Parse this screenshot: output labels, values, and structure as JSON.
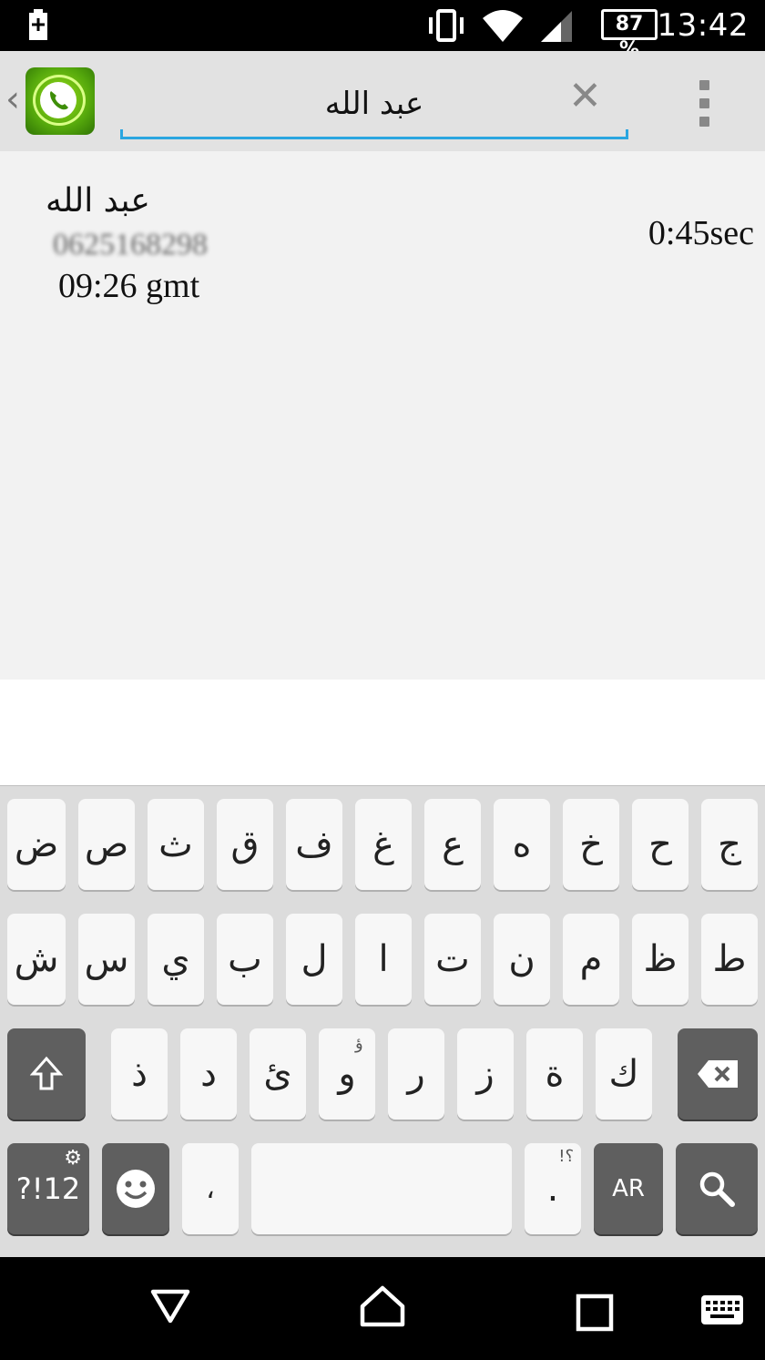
{
  "status_bar": {
    "time": "13:42",
    "battery_percent": "87 %",
    "icons": [
      "battery-charging-icon",
      "vibrate-icon",
      "wifi-icon",
      "signal-icon"
    ]
  },
  "action_bar": {
    "search_value": "عبد الله",
    "search_placeholder": "",
    "icons": [
      "back-chevron-icon",
      "app-phone-icon",
      "clear-icon",
      "overflow-menu-icon"
    ]
  },
  "result": {
    "name": "عبد الله",
    "number": "0625168298",
    "time": "09:26 gmt",
    "duration": "0:45sec"
  },
  "keyboard": {
    "row1": [
      "ض",
      "ص",
      "ث",
      "ق",
      "ف",
      "غ",
      "ع",
      "ه",
      "خ",
      "ح",
      "ج"
    ],
    "row2": [
      "ش",
      "س",
      "ي",
      "ب",
      "ل",
      "ا",
      "ت",
      "ن",
      "م",
      "ظ",
      "ط"
    ],
    "row3": [
      "ذ",
      "د",
      "ئ",
      "و",
      "ر",
      "ز",
      "ة",
      "ك"
    ],
    "row3_hint": "ؤ",
    "symbols_label": "?!12",
    "comma": "،",
    "period": ".",
    "period_hint": "!؟",
    "language": "AR"
  },
  "colors": {
    "accent": "#2aa6e0",
    "status_bar": "#000000",
    "action_bar": "#e2e2e2",
    "key_dark": "#5f5f5f"
  }
}
